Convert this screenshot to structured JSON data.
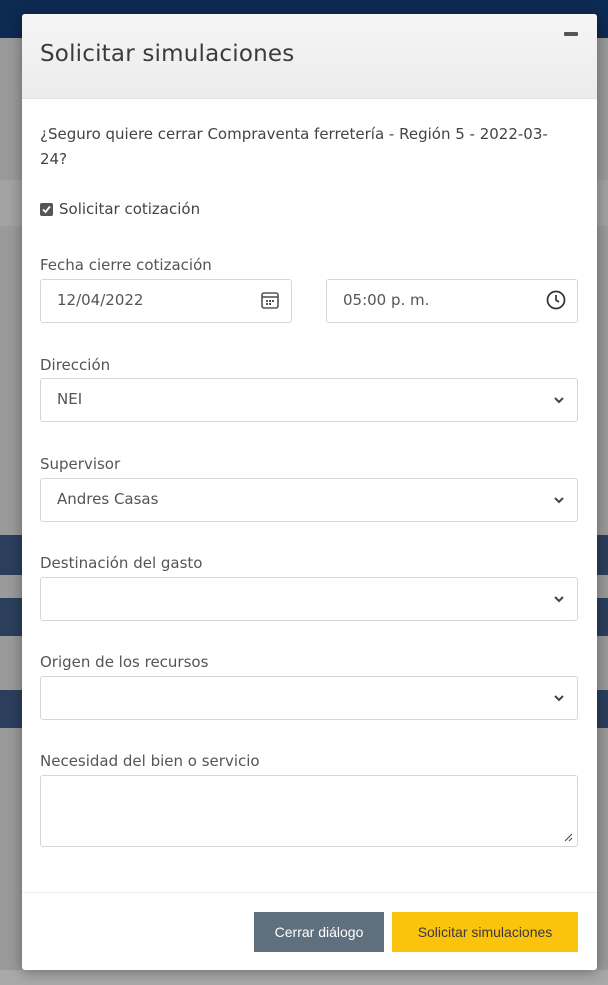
{
  "dialog": {
    "title": "Solicitar simulaciones",
    "confirm_message": "¿Seguro quiere cerrar Compraventa ferretería - Región 5 - 2022-03-24?",
    "checkbox_label": "Solicitar cotización",
    "checkbox_checked": true
  },
  "form": {
    "close_date_label": "Fecha cierre cotización",
    "date_value": "12/04/2022",
    "time_value": "05:00 p. m.",
    "direction_label": "Dirección",
    "direction_value": "NEI",
    "supervisor_label": "Supervisor",
    "supervisor_value": "Andres Casas",
    "expense_label": "Destinación del gasto",
    "expense_value": "",
    "resources_label": "Origen de los recursos",
    "resources_value": "",
    "need_label": "Necesidad del bien o servicio",
    "need_value": ""
  },
  "buttons": {
    "close_label": "Cerrar diálogo",
    "submit_label": "Solicitar simulaciones"
  },
  "colors": {
    "submit": "#fcc30c",
    "close": "#5f6f7d",
    "overlay_header": "#0d2a52"
  },
  "icons": {
    "calendar": "calendar-icon",
    "clock": "clock-icon",
    "chevron": "chevron-down-icon",
    "minimize": "minimize-icon"
  }
}
